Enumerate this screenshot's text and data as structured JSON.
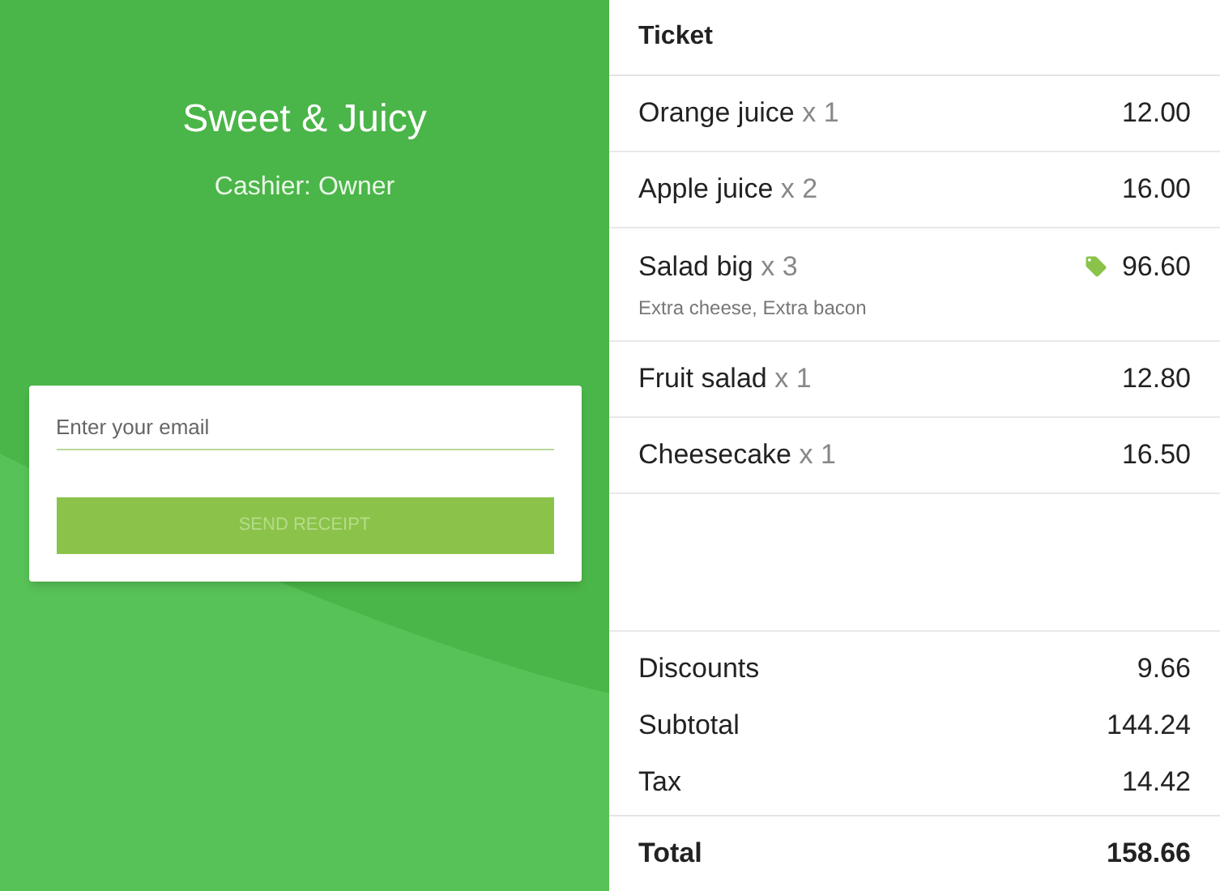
{
  "store": {
    "name": "Sweet & Juicy",
    "cashier": "Cashier: Owner"
  },
  "receipt_form": {
    "email_placeholder": "Enter your email",
    "send_button": {
      "label": "SEND RECEIPT",
      "disabled": true
    }
  },
  "ticket": {
    "title": "Ticket",
    "items": [
      {
        "name": "Orange juice",
        "quantity": "x 1",
        "price": "12.00",
        "discounted": false
      },
      {
        "name": "Apple juice",
        "quantity": "x 2",
        "price": "16.00",
        "discounted": false
      },
      {
        "name": "Salad big",
        "quantity": "x 3",
        "price": "96.60",
        "discounted": true,
        "note": "Extra cheese, Extra bacon"
      },
      {
        "name": "Fruit salad",
        "quantity": "x 1",
        "price": "12.80",
        "discounted": false
      },
      {
        "name": "Cheesecake",
        "quantity": "x 1",
        "price": "16.50",
        "discounted": false
      }
    ],
    "summary": [
      {
        "label": "Discounts",
        "value": "9.66"
      },
      {
        "label": "Subtotal",
        "value": "144.24"
      },
      {
        "label": "Tax",
        "value": "14.42"
      }
    ],
    "total": {
      "label": "Total",
      "value": "158.66"
    }
  }
}
